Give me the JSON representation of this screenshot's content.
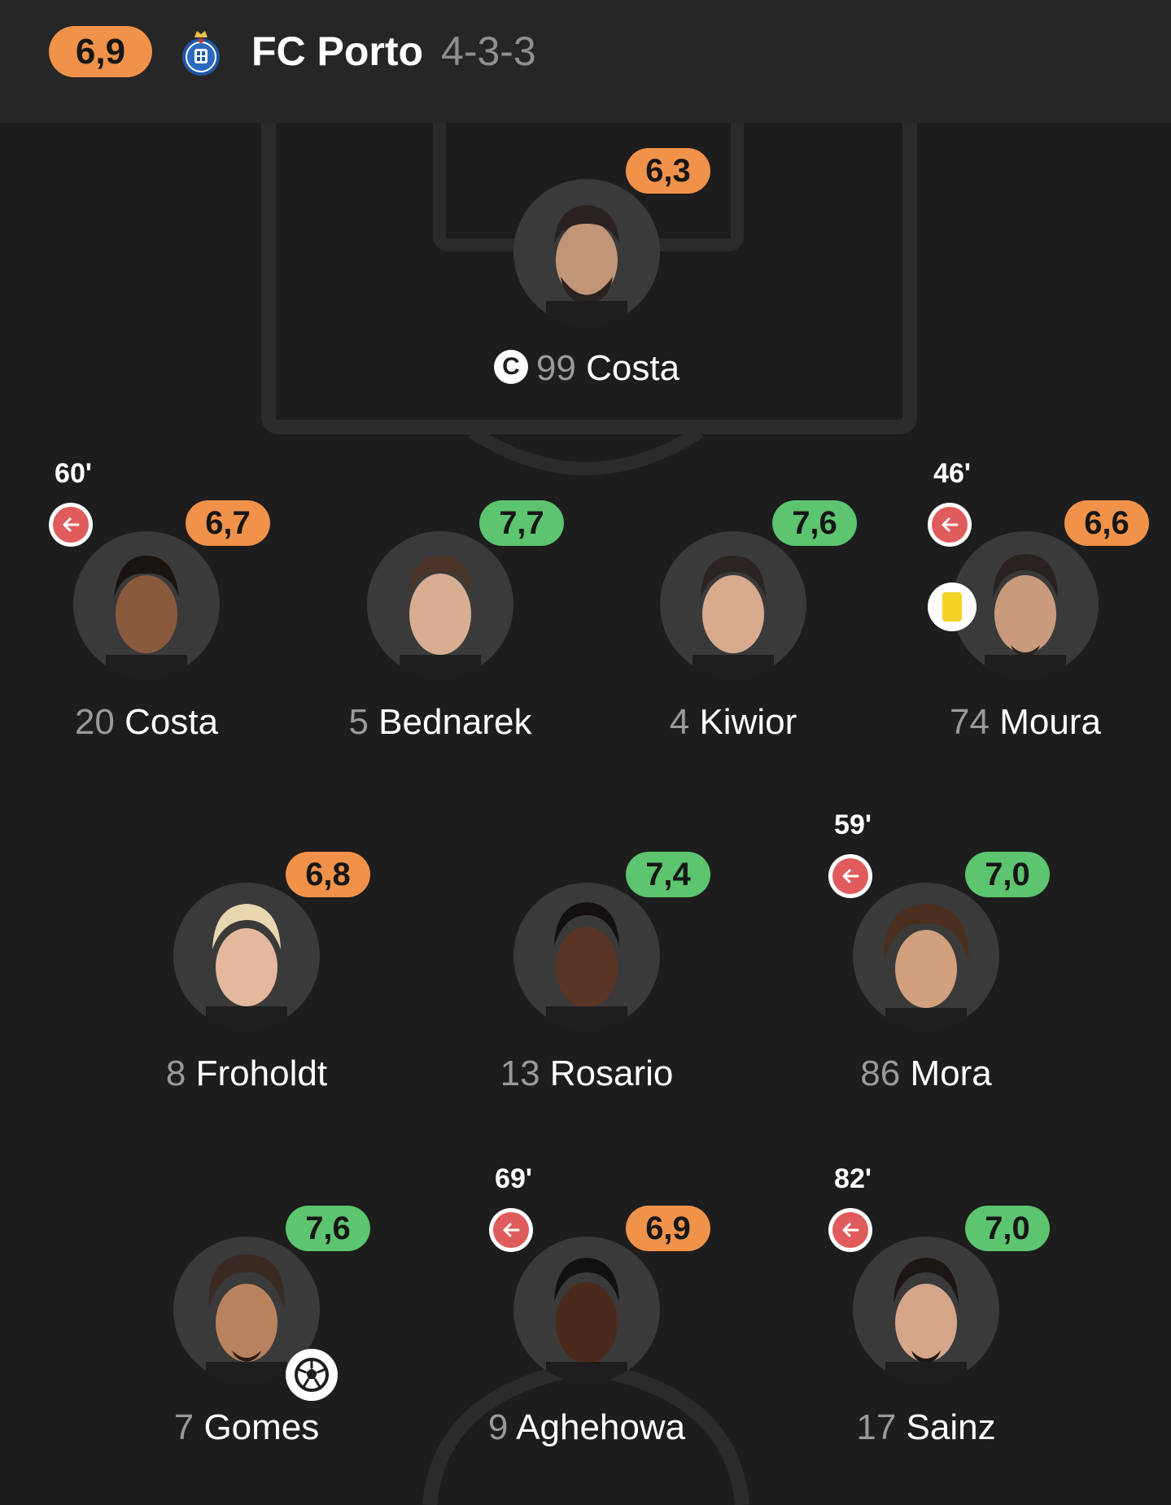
{
  "header": {
    "team_rating": "6,9",
    "team_name": "FC Porto",
    "formation": "4-3-3",
    "crest_icon": "fc-porto-crest-icon"
  },
  "colors": {
    "rating_orange": "#f0924a",
    "rating_green": "#5dc46f",
    "sub_red": "#e05c5c",
    "yellow_card": "#f5d226"
  },
  "players": {
    "gk": {
      "number": "99",
      "name": "Costa",
      "rating": "6,3",
      "captain": "C"
    },
    "lb": {
      "number": "20",
      "name": "Costa",
      "rating": "6,7",
      "sub_minute": "60'"
    },
    "cb1": {
      "number": "5",
      "name": "Bednarek",
      "rating": "7,7"
    },
    "cb2": {
      "number": "4",
      "name": "Kiwior",
      "rating": "7,6"
    },
    "rb": {
      "number": "74",
      "name": "Moura",
      "rating": "6,6",
      "sub_minute": "46'",
      "yellow_card": true
    },
    "cm1": {
      "number": "8",
      "name": "Froholdt",
      "rating": "6,8"
    },
    "cm2": {
      "number": "13",
      "name": "Rosario",
      "rating": "7,4"
    },
    "cm3": {
      "number": "86",
      "name": "Mora",
      "rating": "7,0",
      "sub_minute": "59'"
    },
    "fw1": {
      "number": "7",
      "name": "Gomes",
      "rating": "7,6",
      "goal": true
    },
    "fw2": {
      "number": "9",
      "name": "Aghehowa",
      "rating": "6,9",
      "sub_minute": "69'"
    },
    "fw3": {
      "number": "17",
      "name": "Sainz",
      "rating": "7,0",
      "sub_minute": "82'"
    }
  }
}
